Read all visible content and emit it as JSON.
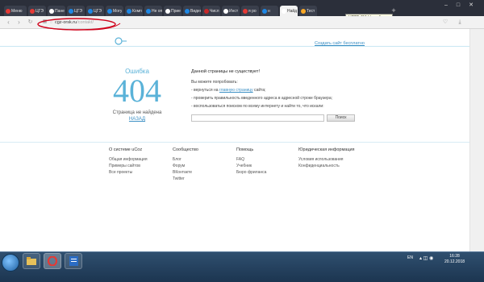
{
  "browser": {
    "opera_label": "Меню",
    "tabs": [
      {
        "label": "ЦГЭ",
        "color": "#e53935"
      },
      {
        "label": "Пане",
        "color": "#ffffff"
      },
      {
        "label": "ЦГЭ",
        "color": "#1e88e5"
      },
      {
        "label": "ЦГЭ",
        "color": "#1e88e5"
      },
      {
        "label": "Могу",
        "color": "#1e88e5"
      },
      {
        "label": "Комп",
        "color": "#1e88e5"
      },
      {
        "label": "Не оп",
        "color": "#1e88e5"
      },
      {
        "label": "Прие",
        "color": "#ffffff"
      },
      {
        "label": "Видео",
        "color": "#1e88e5"
      },
      {
        "label": "Числ",
        "color": "#c62828"
      },
      {
        "label": "Инст",
        "color": "#ffffff"
      },
      {
        "label": "я ро",
        "color": "#e53935"
      },
      {
        "label": "н",
        "color": "#1e88e5"
      },
      {
        "label": "Найд",
        "color": "#ffffff"
      },
      {
        "label": "Тест",
        "color": "#f9a825"
      }
    ],
    "tooltip": "HTTP 404 Не найдено",
    "url_host": "cgz-orsk.ru",
    "url_path": "/contakt/"
  },
  "page": {
    "create_site_link": "Создать сайт бесплатно",
    "error_word": "Ошибка",
    "error_code": "404",
    "error_sub": "Страница не найдена",
    "back_link": "НАЗАД",
    "title": "Данной страницы не существует!",
    "try_text": "Вы можете попробовать:",
    "option1_prefix": "- вернуться на ",
    "option1_link": "главную страницу",
    "option1_suffix": " сайта;",
    "option2": "- проверить правильность введенного адреса в адресной строке браузера;",
    "option3": "- воспользоваться поиском по всему интернету и найти то, что искали:",
    "search_button": "Поиск"
  },
  "footer": {
    "columns": [
      {
        "heading": "О системе uCoz",
        "links": [
          "Общая информация",
          "Примеры сайтов",
          "Все проекты"
        ]
      },
      {
        "heading": "Сообщество",
        "links": [
          "Блог",
          "Форум",
          "ВКонтакте",
          "Twitter"
        ]
      },
      {
        "heading": "Помощь",
        "links": [
          "FAQ",
          "Учебник",
          "Бюро фриланса"
        ]
      },
      {
        "heading": "Юридическая информация",
        "links": [
          "Условия использования",
          "Конфиденциальность"
        ]
      }
    ]
  },
  "taskbar": {
    "lang": "EN",
    "time": "16:28",
    "date": "20.12.2018"
  },
  "colors": {
    "accent": "#5ab2d8",
    "link": "#3b8fc4",
    "annotation": "#d0021b"
  }
}
